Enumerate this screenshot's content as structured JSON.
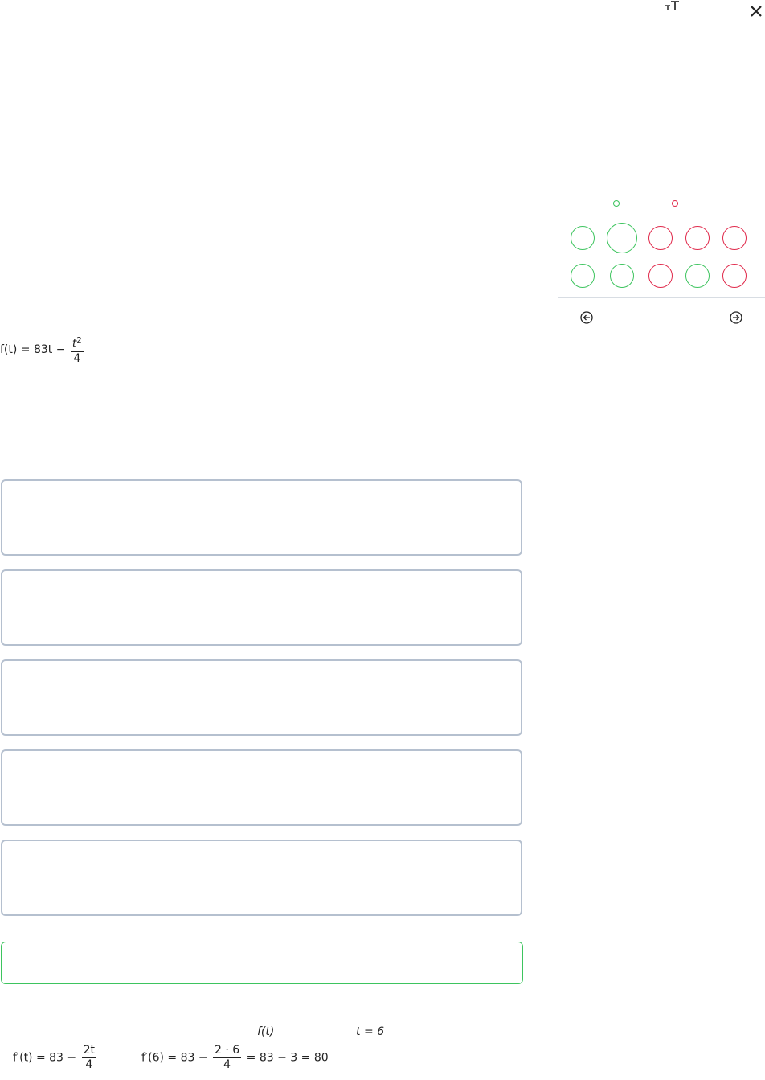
{
  "header": {
    "text_size_icon": "text-size-icon",
    "close_icon": "close-icon"
  },
  "colors": {
    "correct": "#3dc45e",
    "incorrect": "#e0284a",
    "box_border": "#b5c0cf",
    "divider": "#c8cfd8"
  },
  "legend": [
    {
      "status": "correct"
    },
    {
      "status": "incorrect"
    }
  ],
  "question_grid": [
    {
      "status": "correct"
    },
    {
      "status": "correct",
      "current": true
    },
    {
      "status": "incorrect"
    },
    {
      "status": "incorrect"
    },
    {
      "status": "incorrect"
    },
    {
      "status": "correct"
    },
    {
      "status": "correct"
    },
    {
      "status": "incorrect"
    },
    {
      "status": "correct"
    },
    {
      "status": "incorrect"
    }
  ],
  "nav": {
    "prev_icon": "arrow-left-circle-icon",
    "next_icon": "arrow-right-circle-icon"
  },
  "question": {
    "function_lhs": "f(t) = 83t −",
    "function_frac_num": "t",
    "function_frac_exp": "2",
    "function_frac_den": "4"
  },
  "options": [
    "",
    "",
    "",
    "",
    ""
  ],
  "solution": {
    "f_of_t": "f(t)",
    "t_equals": "t = 6",
    "derivative_lhs": "f′(t) = 83 −",
    "derivative_num": "2t",
    "derivative_den": "4",
    "eval_lhs": "f′(6) = 83 −",
    "eval_num": "2 · 6",
    "eval_den": "4",
    "eval_rhs": "= 83 − 3 = 80"
  }
}
